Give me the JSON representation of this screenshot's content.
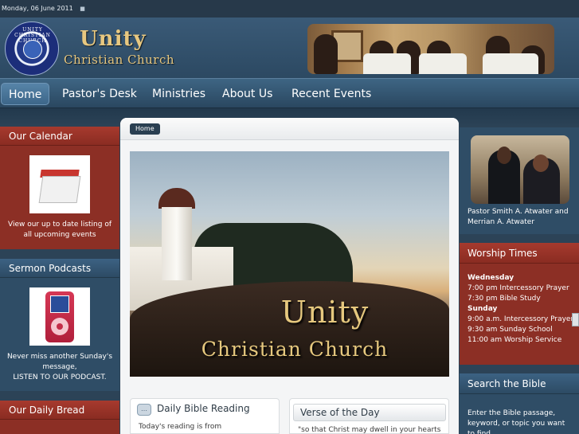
{
  "date": "Monday, 06 June 2011",
  "header": {
    "brand_line1": "Unity",
    "brand_line2": "Christian Church",
    "logo_ring": "UNITY CHRISTIAN CHURCH"
  },
  "nav": {
    "items": [
      {
        "label": "Home",
        "active": true
      },
      {
        "label": "Pastor's Desk"
      },
      {
        "label": "Ministries"
      },
      {
        "label": "About Us"
      },
      {
        "label": "Recent Events"
      }
    ]
  },
  "left": {
    "calendar": {
      "title": "Our Calendar",
      "text": "View our up to date listing of all upcoming events",
      "image_label": "Calendar"
    },
    "podcasts": {
      "title": "Sermon Podcasts",
      "text1": "Never miss another Sunday's message,",
      "text2": "LISTEN TO OUR PODCAST."
    },
    "bread": {
      "title": "Our Daily Bread"
    }
  },
  "main": {
    "breadcrumb": "Home",
    "hero_line1": "Unity",
    "hero_line2": "Christian Church",
    "reading": {
      "title": "Daily Bible Reading",
      "text": "Today's reading is from"
    },
    "verse": {
      "title": "Verse of the Day",
      "text": "\"so that Christ may dwell in your hearts"
    }
  },
  "right": {
    "pastor_caption": "Pastor Smith A. Atwater and Merrian A. Atwater",
    "worship": {
      "title": "Worship Times",
      "wed_label": "Wednesday",
      "wed_items": [
        "7:00 pm Intercessory Prayer",
        "7:30 pm Bible Study"
      ],
      "sun_label": "Sunday",
      "sun_items": [
        "9:00 a.m. Intercessory Prayer",
        "9:30 am Sunday School",
        "11:00 am Worship Service"
      ]
    },
    "search": {
      "title": "Search the Bible",
      "text": "Enter the Bible passage, keyword, or topic you want to find"
    }
  },
  "colors": {
    "accent_red": "#8c2f25",
    "nav_blue": "#2a4760",
    "gold": "#e6c87e"
  }
}
